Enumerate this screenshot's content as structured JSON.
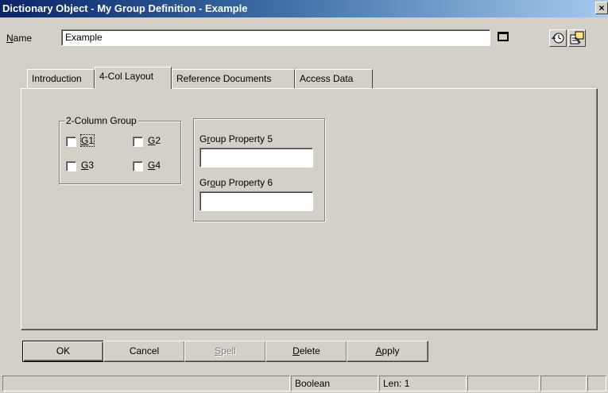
{
  "window": {
    "title": "Dictionary Object - My Group Definition - Example",
    "close_glyph": "×"
  },
  "name_row": {
    "label_accel": "N",
    "label_rest": "ame",
    "value": "Example"
  },
  "tabs": [
    {
      "label": "Introduction",
      "active": false
    },
    {
      "label": "4-Col Layout",
      "active": true
    },
    {
      "label": "Reference Documents",
      "active": false
    },
    {
      "label": "Access Data",
      "active": false
    }
  ],
  "group": {
    "legend": "2-Column Group",
    "checkboxes": [
      {
        "accel": "G",
        "rest": "1",
        "checked": false
      },
      {
        "accel": "G",
        "rest": "2",
        "checked": false
      },
      {
        "accel": "G",
        "rest": "3",
        "checked": false
      },
      {
        "accel": "G",
        "rest": "4",
        "checked": false
      }
    ]
  },
  "properties": [
    {
      "pre": "G",
      "accel": "r",
      "post": "oup Property 5",
      "value": ""
    },
    {
      "pre": "Gr",
      "accel": "o",
      "post": "up Property 6",
      "value": ""
    }
  ],
  "buttons": {
    "ok": "OK",
    "cancel": "Cancel",
    "spell": {
      "accel": "S",
      "rest": "pell"
    },
    "delete": {
      "accel": "D",
      "rest": "elete"
    },
    "apply": {
      "accel": "A",
      "rest": "pply"
    }
  },
  "status_bar": {
    "type": "Boolean",
    "length": "Len: 1"
  },
  "icons": {
    "maximize": "maximize-field-icon",
    "history": "history-clock-icon",
    "properties": "object-properties-icon"
  },
  "colors": {
    "title_start": "#0a246a",
    "title_end": "#a6caf0",
    "face": "#d4d0c8"
  }
}
